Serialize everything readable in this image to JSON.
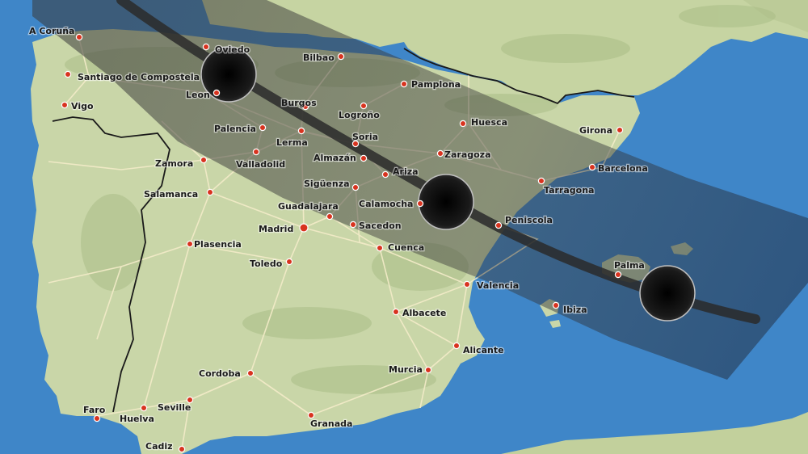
{
  "map": {
    "colors": {
      "sea": "#3f86c8",
      "land": "#c9d6a8",
      "land_dark": "#a9bd86",
      "road": "#f2e9c8",
      "border": "#1a1a1a",
      "city_dot": "#d8331f",
      "eclipse_path": "#2a2a2a",
      "eclipse_disc": "#111111"
    },
    "cities": [
      {
        "id": "a-coruna",
        "name": "A Coruña"
      },
      {
        "id": "santiago",
        "name": "Santiago de Compostela"
      },
      {
        "id": "vigo",
        "name": "Vigo"
      },
      {
        "id": "oviedo",
        "name": "Oviedo"
      },
      {
        "id": "leon",
        "name": "Leon"
      },
      {
        "id": "bilbao",
        "name": "Bilbao"
      },
      {
        "id": "pamplona",
        "name": "Pamplona"
      },
      {
        "id": "burgos",
        "name": "Burgos"
      },
      {
        "id": "logrono",
        "name": "Logroño"
      },
      {
        "id": "palencia",
        "name": "Palencia"
      },
      {
        "id": "lerma",
        "name": "Lerma"
      },
      {
        "id": "soria",
        "name": "Soria"
      },
      {
        "id": "huesca",
        "name": "Huesca"
      },
      {
        "id": "girona",
        "name": "Girona"
      },
      {
        "id": "zamora",
        "name": "Zamora"
      },
      {
        "id": "valladolid",
        "name": "Valladolid"
      },
      {
        "id": "almazan",
        "name": "Almazán"
      },
      {
        "id": "zaragoza",
        "name": "Zaragoza"
      },
      {
        "id": "ariza",
        "name": "Ariza"
      },
      {
        "id": "barcelona",
        "name": "Barcelona"
      },
      {
        "id": "siguenza",
        "name": "Sigüenza"
      },
      {
        "id": "tarragona",
        "name": "Tarragona"
      },
      {
        "id": "salamanca",
        "name": "Salamanca"
      },
      {
        "id": "guadalajara",
        "name": "Guadalajara"
      },
      {
        "id": "calamocha",
        "name": "Calamocha"
      },
      {
        "id": "madrid",
        "name": "Madrid"
      },
      {
        "id": "sacedon",
        "name": "Sacedon"
      },
      {
        "id": "peniscola",
        "name": "Peniscola"
      },
      {
        "id": "plasencia",
        "name": "Plasencia"
      },
      {
        "id": "cuenca",
        "name": "Cuenca"
      },
      {
        "id": "palma",
        "name": "Palma"
      },
      {
        "id": "toledo",
        "name": "Toledo"
      },
      {
        "id": "valencia",
        "name": "Valencia"
      },
      {
        "id": "ibiza",
        "name": "Ibiza"
      },
      {
        "id": "albacete",
        "name": "Albacete"
      },
      {
        "id": "alicante",
        "name": "Alicante"
      },
      {
        "id": "cordoba",
        "name": "Cordoba"
      },
      {
        "id": "murcia",
        "name": "Murcia"
      },
      {
        "id": "faro",
        "name": "Faro"
      },
      {
        "id": "huelva",
        "name": "Huelva"
      },
      {
        "id": "seville",
        "name": "Seville"
      },
      {
        "id": "granada",
        "name": "Granada"
      },
      {
        "id": "cadiz",
        "name": "Cadiz"
      }
    ]
  }
}
